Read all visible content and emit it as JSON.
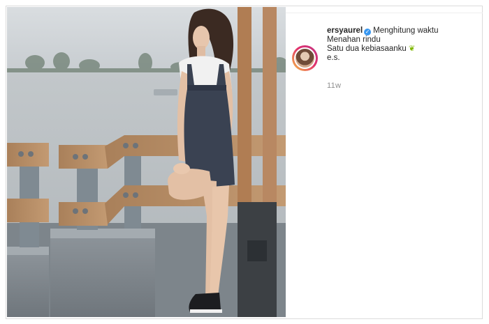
{
  "post": {
    "username": "ersyaurel",
    "verified_badge": "verified-badge-icon",
    "caption_first": "Menghitung waktu",
    "caption_lines": [
      "Menahan rindu",
      "Satu dua kebiasaanku",
      "e.s."
    ],
    "caption_emoji": "leaf-emoji",
    "timestamp": "11w"
  },
  "photo": {
    "subject": "woman-on-pier-photo"
  },
  "colors": {
    "border": "#dbdbdb",
    "text": "#262626",
    "muted": "#8e8e8e",
    "verified_blue": "#3897f0"
  }
}
